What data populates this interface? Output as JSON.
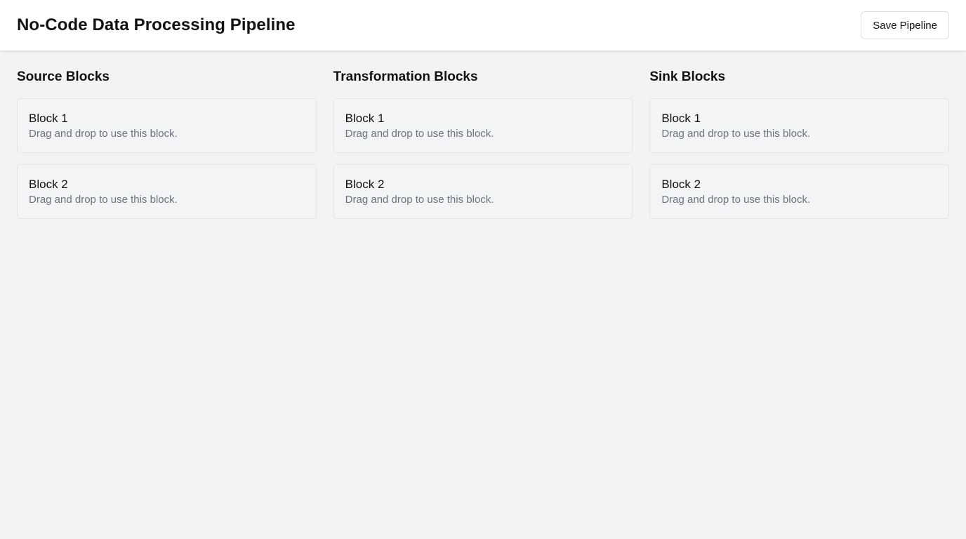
{
  "header": {
    "title": "No-Code Data Processing Pipeline",
    "save_label": "Save Pipeline"
  },
  "columns": [
    {
      "title": "Source Blocks",
      "blocks": [
        {
          "name": "Block 1",
          "description": "Drag and drop to use this block."
        },
        {
          "name": "Block 2",
          "description": "Drag and drop to use this block."
        }
      ]
    },
    {
      "title": "Transformation Blocks",
      "blocks": [
        {
          "name": "Block 1",
          "description": "Drag and drop to use this block."
        },
        {
          "name": "Block 2",
          "description": "Drag and drop to use this block."
        }
      ]
    },
    {
      "title": "Sink Blocks",
      "blocks": [
        {
          "name": "Block 1",
          "description": "Drag and drop to use this block."
        },
        {
          "name": "Block 2",
          "description": "Drag and drop to use this block."
        }
      ]
    }
  ],
  "colors": {
    "background": "#f2f3f5",
    "header_background": "#ffffff",
    "card_background": "#f3f4f6",
    "card_border": "#e3e5e8",
    "muted_text": "#6b7280"
  }
}
